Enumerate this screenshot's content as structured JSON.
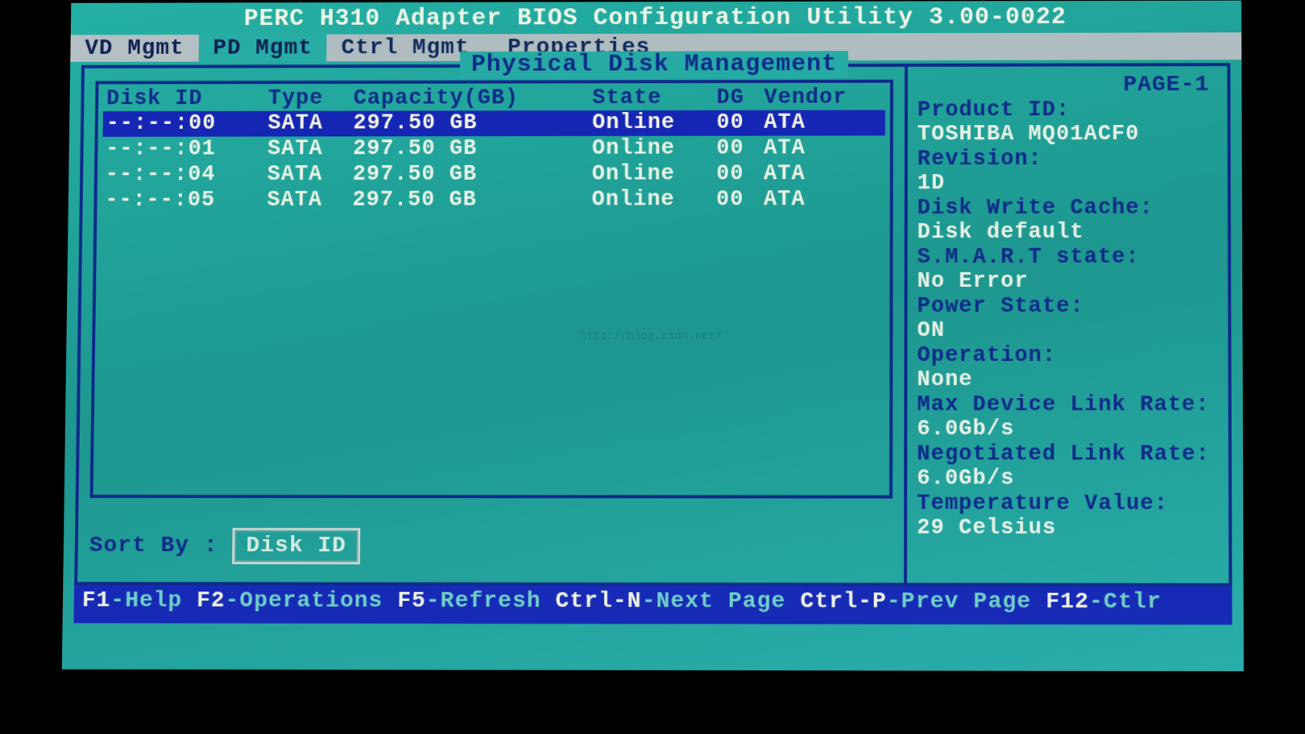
{
  "title": "PERC H310 Adapter BIOS Configuration Utility 3.00-0022",
  "tabs": {
    "vd": "VD Mgmt",
    "pd": "PD Mgmt",
    "ctrl": "Ctrl Mgmt",
    "prop": "Properties"
  },
  "frame_title": "Physical Disk Management",
  "columns": {
    "disk_id": "Disk ID",
    "type": "Type",
    "capacity": "Capacity(GB)",
    "state": "State",
    "dg": "DG",
    "vendor": "Vendor"
  },
  "disks": [
    {
      "id": "--:--:00",
      "type": "SATA",
      "capacity": "297.50 GB",
      "state": "Online",
      "dg": "00",
      "vendor": "ATA",
      "selected": true
    },
    {
      "id": "--:--:01",
      "type": "SATA",
      "capacity": "297.50 GB",
      "state": "Online",
      "dg": "00",
      "vendor": "ATA",
      "selected": false
    },
    {
      "id": "--:--:04",
      "type": "SATA",
      "capacity": "297.50 GB",
      "state": "Online",
      "dg": "00",
      "vendor": "ATA",
      "selected": false
    },
    {
      "id": "--:--:05",
      "type": "SATA",
      "capacity": "297.50 GB",
      "state": "Online",
      "dg": "00",
      "vendor": "ATA",
      "selected": false
    }
  ],
  "sort_by_label": "Sort By :",
  "sort_by_value": "Disk ID",
  "page_indicator": "PAGE-1",
  "details": {
    "product_id_label": "Product ID:",
    "product_id": "TOSHIBA MQ01ACF0",
    "revision_label": "Revision:",
    "revision": "1D",
    "write_cache_label": "Disk Write Cache:",
    "write_cache": "Disk default",
    "smart_label": "S.M.A.R.T state:",
    "smart": "No Error",
    "power_label": "Power State:",
    "power": "ON",
    "operation_label": "Operation:",
    "operation": "None",
    "max_link_label": "Max Device Link Rate:",
    "max_link": "6.0Gb/s",
    "neg_link_label": "Negotiated Link Rate:",
    "neg_link": "6.0Gb/s",
    "temp_label": "Temperature Value:",
    "temp": "29 Celsius"
  },
  "footer": {
    "f1_key": "F1",
    "f1_act": "-Help",
    "f2_key": "F2",
    "f2_act": "-Operations",
    "f5_key": "F5",
    "f5_act": "-Refresh",
    "cn_key": "Ctrl-N",
    "cn_act": "-Next Page",
    "cp_key": "Ctrl-P",
    "cp_act": "-Prev Page",
    "f12_key": "F12",
    "f12_act": "-Ctlr"
  },
  "watermark": "http://blog.csdn.net/"
}
